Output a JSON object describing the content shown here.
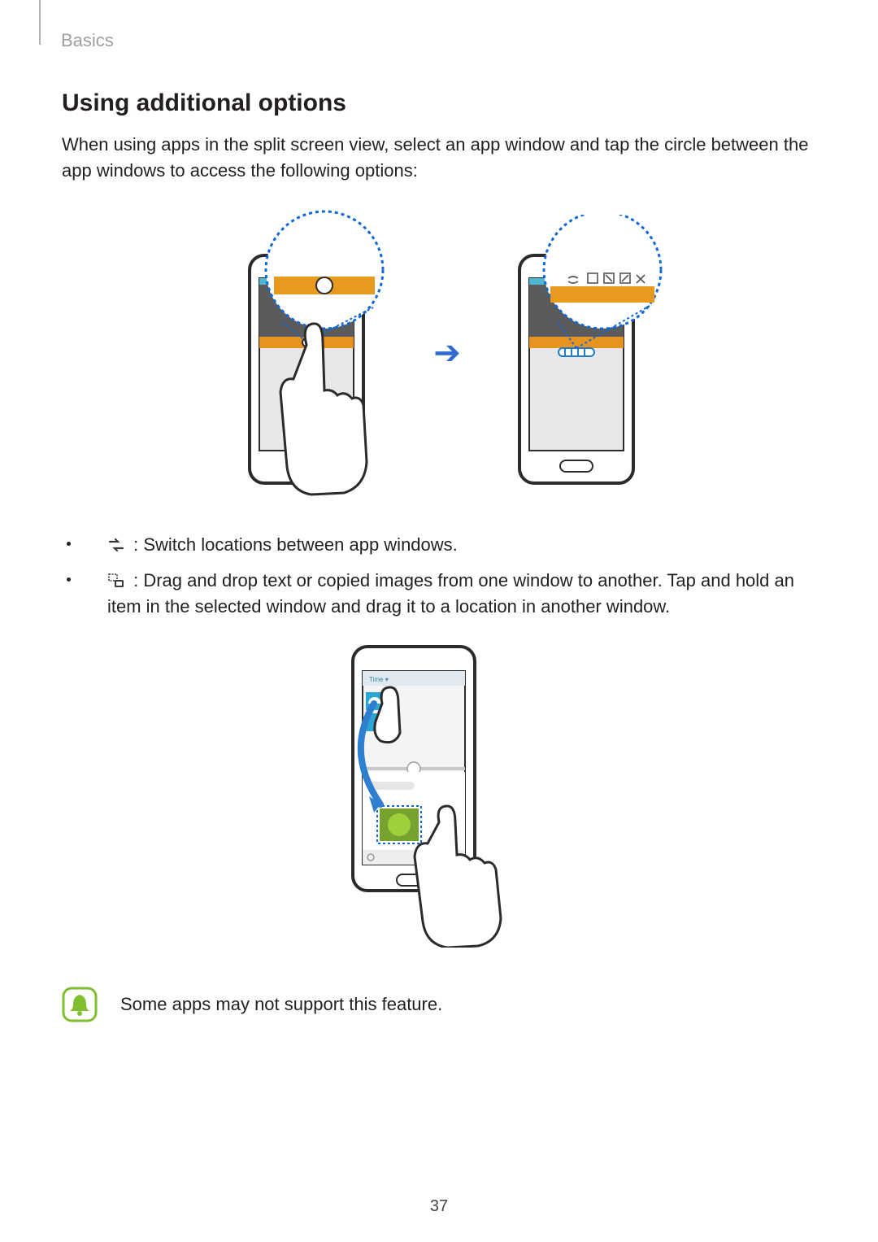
{
  "breadcrumb": "Basics",
  "section_title": "Using additional options",
  "intro_paragraph": "When using apps in the split screen view, select an app window and tap the circle between the app windows to access the following options:",
  "bullet_switch": " : Switch locations between app windows.",
  "bullet_drag": " : Drag and drop text or copied images from one window to another. Tap and hold an item in the selected window and drag it to a location in another window.",
  "note_text": "Some apps may not support this feature.",
  "page_number": "37",
  "icons": {
    "switch": "switch-windows-icon",
    "drag": "drag-drop-icon",
    "note": "bell-note-icon"
  }
}
